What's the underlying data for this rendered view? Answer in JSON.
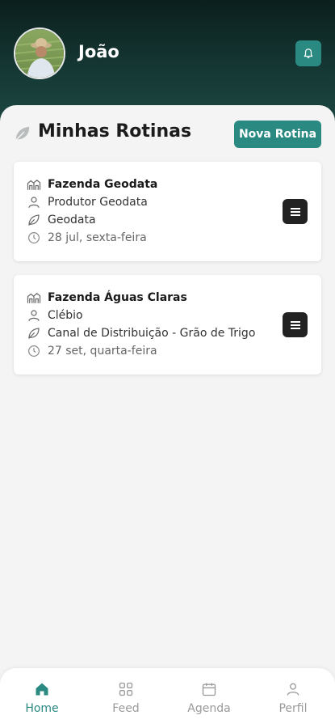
{
  "header": {
    "user_name": "João",
    "avatar_icon": "farmer-photo",
    "notification_icon": "bell-icon"
  },
  "section": {
    "title": "Minhas Rotinas",
    "new_button_label": "Nova Rotina"
  },
  "routines": [
    {
      "farm": "Fazenda Geodata",
      "producer": "Produtor Geodata",
      "crop": "Geodata",
      "date": "28 jul, sexta-feira"
    },
    {
      "farm": "Fazenda Águas Claras",
      "producer": "Clébio",
      "crop": "Canal de Distribuição - Grão de Trigo",
      "date": "27 set, quarta-feira"
    }
  ],
  "nav": {
    "items": [
      {
        "label": "Home",
        "icon": "home-icon",
        "active": true
      },
      {
        "label": "Feed",
        "icon": "grid-icon",
        "active": false
      },
      {
        "label": "Agenda",
        "icon": "calendar-icon",
        "active": false
      },
      {
        "label": "Perfil",
        "icon": "user-icon",
        "active": false
      }
    ]
  },
  "colors": {
    "accent": "#2a8a82",
    "header_dark": "#0b1f1d",
    "background": "#f4f4f4",
    "card": "#ffffff"
  }
}
